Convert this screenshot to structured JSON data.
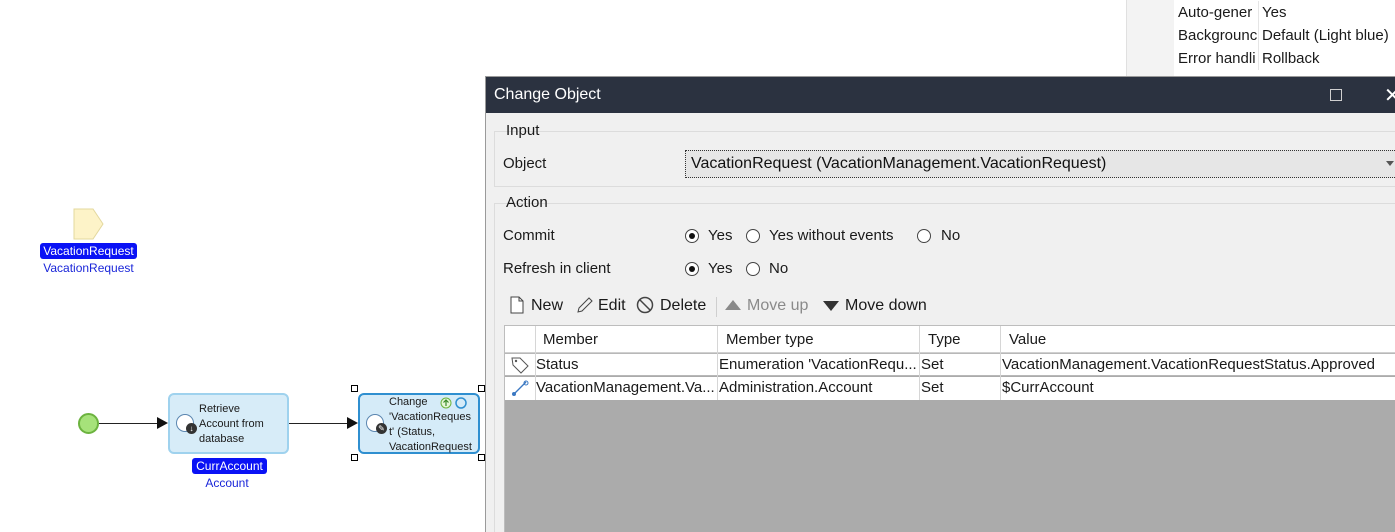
{
  "properties": [
    {
      "key": "Auto-gener",
      "value": "Yes"
    },
    {
      "key": "Backgrounc",
      "value": "Default (Light blue)"
    },
    {
      "key": "Error handli",
      "value": "Rollback"
    }
  ],
  "canvas": {
    "parameter": {
      "name": "VacationRequest",
      "type": "VacationRequest"
    },
    "retrieve_activity": {
      "text_lines": [
        "Retrieve",
        "Account from",
        "database"
      ],
      "output_name": "CurrAccount",
      "output_type": "Account"
    },
    "change_activity": {
      "text_lines": [
        "Change",
        "'VacationReques",
        "t' (Status,",
        "VacationRequest"
      ]
    }
  },
  "dialog": {
    "title": "Change Object",
    "input_group": {
      "label": "Input",
      "object_label": "Object",
      "object_value": "VacationRequest (VacationManagement.VacationRequest)"
    },
    "action_group": {
      "label": "Action",
      "commit_label": "Commit",
      "commit_options": [
        "Yes",
        "Yes without events",
        "No"
      ],
      "commit_selected": "Yes",
      "refresh_label": "Refresh in client",
      "refresh_options": [
        "Yes",
        "No"
      ],
      "refresh_selected": "Yes"
    },
    "toolbar": {
      "new": "New",
      "edit": "Edit",
      "delete": "Delete",
      "move_up": "Move up",
      "move_down": "Move down"
    },
    "grid": {
      "columns": [
        "Member",
        "Member type",
        "Type",
        "Value"
      ],
      "rows": [
        {
          "icon": "tag-icon",
          "member": "Status",
          "member_type": "Enumeration 'VacationRequ...",
          "type": "Set",
          "value": "VacationManagement.VacationRequestStatus.Approved"
        },
        {
          "icon": "association-icon",
          "member": "VacationManagement.Va...",
          "member_type": "Administration.Account",
          "type": "Set",
          "value": "$CurrAccount"
        }
      ]
    }
  }
}
